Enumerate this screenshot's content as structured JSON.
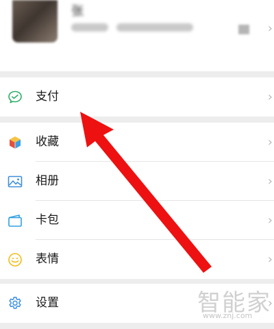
{
  "profile": {
    "name": "张",
    "chevron": "›"
  },
  "menu_groups": [
    [
      {
        "label": "支付",
        "icon": "wallet-pay-icon"
      }
    ],
    [
      {
        "label": "收藏",
        "icon": "favorites-cube-icon"
      },
      {
        "label": "相册",
        "icon": "album-picture-icon"
      },
      {
        "label": "卡包",
        "icon": "card-wallet-icon"
      },
      {
        "label": "表情",
        "icon": "smiley-icon"
      }
    ],
    [
      {
        "label": "设置",
        "icon": "gear-icon"
      }
    ]
  ],
  "chevron": "›",
  "watermark": {
    "brand": "智能家",
    "url": "www.znj.com"
  },
  "colors": {
    "arrow": "#ee1111",
    "pay_icon": "#2aae67",
    "album_icon": "#3e8fd8",
    "card_icon": "#2e9fdf",
    "smiley_icon": "#f2bd1a",
    "gear_icon": "#3a8ee6",
    "background": "#ededed"
  }
}
